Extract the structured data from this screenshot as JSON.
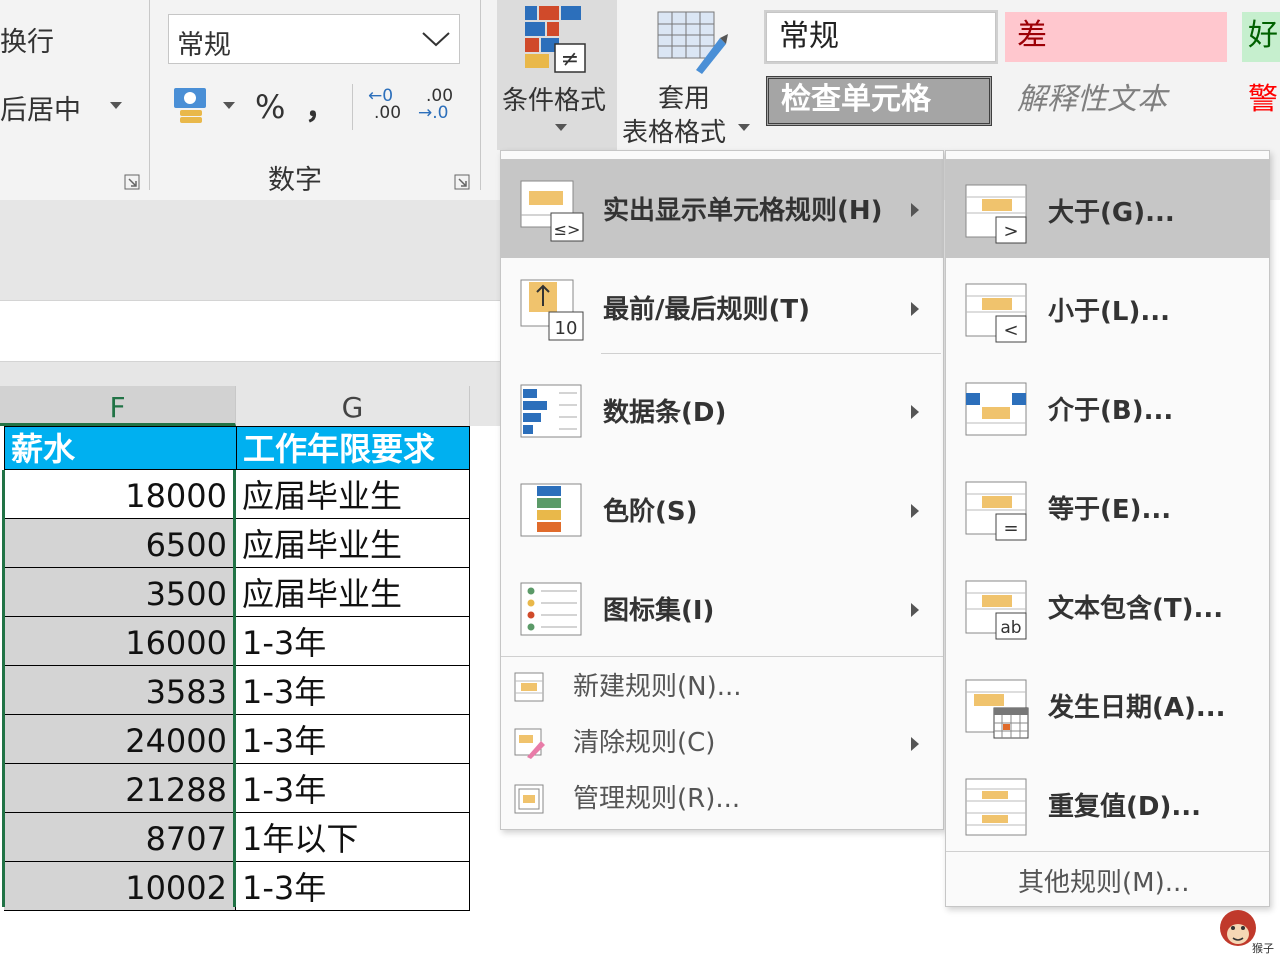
{
  "ribbon": {
    "alignment": {
      "wrap_text": "换行",
      "merge_center": "后居中"
    },
    "number": {
      "format_value": "常规",
      "percent": "%",
      "comma": "，",
      "inc_decimal_top": "←0",
      "inc_decimal_bottom": ".00",
      "dec_decimal_top": ".00",
      "dec_decimal_bottom": "→.0",
      "group_label": "数字"
    },
    "styles": {
      "conditional_format_label": "条件格式",
      "table_format_label_1": "套用",
      "table_format_label_2": "表格格式",
      "cells": [
        "常规",
        "差",
        "好",
        "检查单元格",
        "解释性文本",
        "警"
      ]
    }
  },
  "sheet": {
    "columns": [
      "F",
      "G"
    ],
    "headers": [
      "薪水",
      "工作年限要求"
    ],
    "rows": [
      [
        "18000",
        "应届毕业生"
      ],
      [
        "6500",
        "应届毕业生"
      ],
      [
        "3500",
        "应届毕业生"
      ],
      [
        "16000",
        "1-3年"
      ],
      [
        "3583",
        "1-3年"
      ],
      [
        "24000",
        "1-3年"
      ],
      [
        "21288",
        "1-3年"
      ],
      [
        "8707",
        "1年以下"
      ],
      [
        "10002",
        "1-3年"
      ]
    ]
  },
  "menu": {
    "items": [
      {
        "label": "实出显示单元格规则(H)",
        "icon": "highlight-cells-icon"
      },
      {
        "label": "最前/最后规则(T)",
        "icon": "top-bottom-icon"
      },
      {
        "label": "数据条(D)",
        "icon": "data-bars-icon"
      },
      {
        "label": "色阶(S)",
        "icon": "color-scales-icon"
      },
      {
        "label": "图标集(I)",
        "icon": "icon-sets-icon"
      }
    ],
    "small_items": [
      {
        "label": "新建规则(N)...",
        "icon": "new-rule-icon"
      },
      {
        "label": "清除规则(C)",
        "icon": "clear-rules-icon"
      },
      {
        "label": "管理规则(R)...",
        "icon": "manage-rules-icon"
      }
    ]
  },
  "submenu": {
    "items": [
      {
        "label": "大于(G)...",
        "icon": "greater-than-icon"
      },
      {
        "label": "小于(L)...",
        "icon": "less-than-icon"
      },
      {
        "label": "介于(B)...",
        "icon": "between-icon"
      },
      {
        "label": "等于(E)...",
        "icon": "equal-to-icon"
      },
      {
        "label": "文本包含(T)...",
        "icon": "text-contains-icon"
      },
      {
        "label": "发生日期(A)...",
        "icon": "date-occurring-icon"
      },
      {
        "label": "重复值(D)...",
        "icon": "duplicate-values-icon"
      }
    ],
    "more_rules": "其他规则(M)..."
  },
  "watermark": {
    "text": "猴子"
  },
  "colors": {
    "header_fill": "#00b0f0",
    "selected_fill": "#d4d4d4",
    "bad_fill": "#ffc7ce",
    "bad_text": "#9c0006",
    "good_fill": "#c6efce",
    "good_text": "#006100",
    "check_fill": "#a5a5a5",
    "excel_green": "#217346"
  }
}
